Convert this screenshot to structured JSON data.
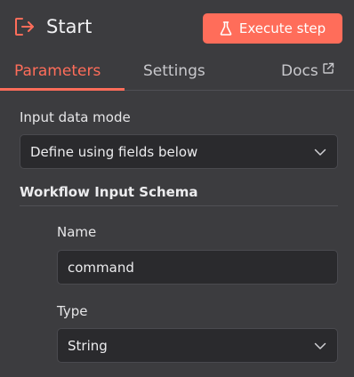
{
  "header": {
    "title": "Start",
    "icon": "exit-icon",
    "execute_label": "Execute step",
    "execute_icon": "flask-icon",
    "accent": "#ff6d5a"
  },
  "tabs": [
    {
      "label": "Parameters",
      "active": true
    },
    {
      "label": "Settings",
      "active": false
    },
    {
      "label": "Docs",
      "active": false,
      "icon": "external-link-icon"
    }
  ],
  "params": {
    "input_mode": {
      "label": "Input data mode",
      "value": "Define using fields below"
    },
    "schema": {
      "title": "Workflow Input Schema",
      "fields": [
        {
          "label": "Name",
          "value": "command"
        },
        {
          "label": "Type",
          "value": "String"
        }
      ]
    }
  }
}
